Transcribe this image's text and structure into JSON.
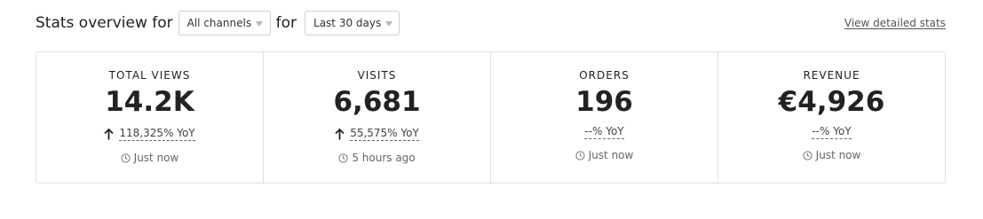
{
  "header": {
    "title_prefix": "Stats overview for",
    "channel_select": "All channels",
    "for_text": "for",
    "period_select": "Last 30 days",
    "detail_link": "View detailed stats"
  },
  "stats": [
    {
      "label": "TOTAL VIEWS",
      "value": "14.2K",
      "change": "118,325% YoY",
      "trend": "up",
      "updated": "Just now"
    },
    {
      "label": "VISITS",
      "value": "6,681",
      "change": "55,575% YoY",
      "trend": "up",
      "updated": "5 hours ago"
    },
    {
      "label": "ORDERS",
      "value": "196",
      "change": "--% YoY",
      "trend": "none",
      "updated": "Just now"
    },
    {
      "label": "REVENUE",
      "value": "€4,926",
      "change": "--% YoY",
      "trend": "none",
      "updated": "Just now"
    }
  ]
}
